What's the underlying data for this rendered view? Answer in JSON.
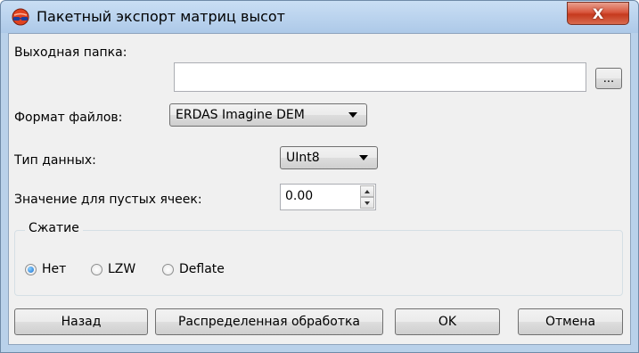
{
  "window": {
    "title": "Пакетный экспорт матриц высот",
    "close_label": "X"
  },
  "form": {
    "output_folder_label": "Выходная папка:",
    "output_folder_value": "",
    "browse_label": "...",
    "file_format_label": "Формат файлов:",
    "file_format_value": "ERDAS Imagine DEM",
    "data_type_label": "Тип данных:",
    "data_type_value": "UInt8",
    "empty_cells_label": "Значение для пустых ячеек:",
    "empty_cells_value": "0.00"
  },
  "compression": {
    "title": "Сжатие",
    "options": [
      {
        "label": "Нет",
        "selected": true
      },
      {
        "label": "LZW",
        "selected": false
      },
      {
        "label": "Deflate",
        "selected": false
      }
    ]
  },
  "buttons": {
    "back": "Назад",
    "distributed": "Распределенная обработка",
    "ok": "OK",
    "cancel": "Отмена"
  },
  "colors": {
    "title_bar": "#b9d1ea",
    "close_button": "#c53a1e",
    "dialog_bg": "#f0f0f0"
  },
  "icons": {
    "app": "globe-glasses-icon",
    "close": "close-icon"
  }
}
